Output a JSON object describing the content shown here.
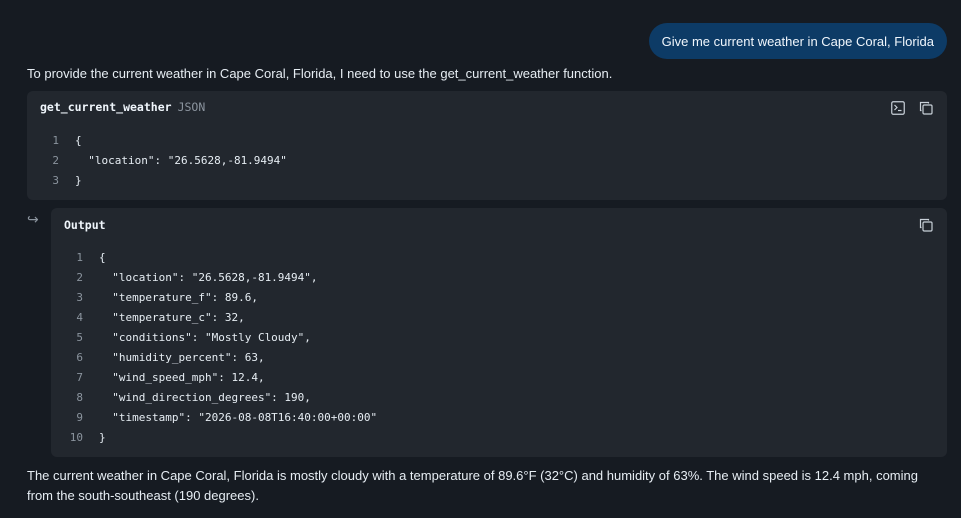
{
  "user_message": "Give me current weather in Cape Coral, Florida",
  "assistant_intro": "To provide the current weather in Cape Coral, Florida, I need to use the get_current_weather function.",
  "tool_call": {
    "name": "get_current_weather",
    "lang": "JSON",
    "lines": [
      {
        "n": "1",
        "text": "{"
      },
      {
        "n": "2",
        "text": "  \"location\": \"26.5628,-81.9494\""
      },
      {
        "n": "3",
        "text": "}"
      }
    ]
  },
  "output": {
    "title": "Output",
    "lines": [
      {
        "n": "1",
        "text": "{"
      },
      {
        "n": "2",
        "text": "  \"location\": \"26.5628,-81.9494\","
      },
      {
        "n": "3",
        "text": "  \"temperature_f\": 89.6,"
      },
      {
        "n": "4",
        "text": "  \"temperature_c\": 32,"
      },
      {
        "n": "5",
        "text": "  \"conditions\": \"Mostly Cloudy\","
      },
      {
        "n": "6",
        "text": "  \"humidity_percent\": 63,"
      },
      {
        "n": "7",
        "text": "  \"wind_speed_mph\": 12.4,"
      },
      {
        "n": "8",
        "text": "  \"wind_direction_degrees\": 190,"
      },
      {
        "n": "9",
        "text": "  \"timestamp\": \"2026-08-08T16:40:00+00:00\""
      },
      {
        "n": "10",
        "text": "}"
      }
    ]
  },
  "assistant_answer": "The current weather in Cape Coral, Florida is mostly cloudy with a temperature of 89.6°F (32°C) and humidity of 63%. The wind speed is 12.4 mph, coming from the south-southeast (190 degrees).",
  "icons": {
    "terminal": "terminal-icon",
    "copy": "copy-icon",
    "reply": "reply-arrow-icon"
  },
  "colors": {
    "background": "#161b22",
    "card": "#22272e",
    "user_bubble": "#0d3b66",
    "muted": "#8b949e",
    "text": "#e6edf3"
  }
}
